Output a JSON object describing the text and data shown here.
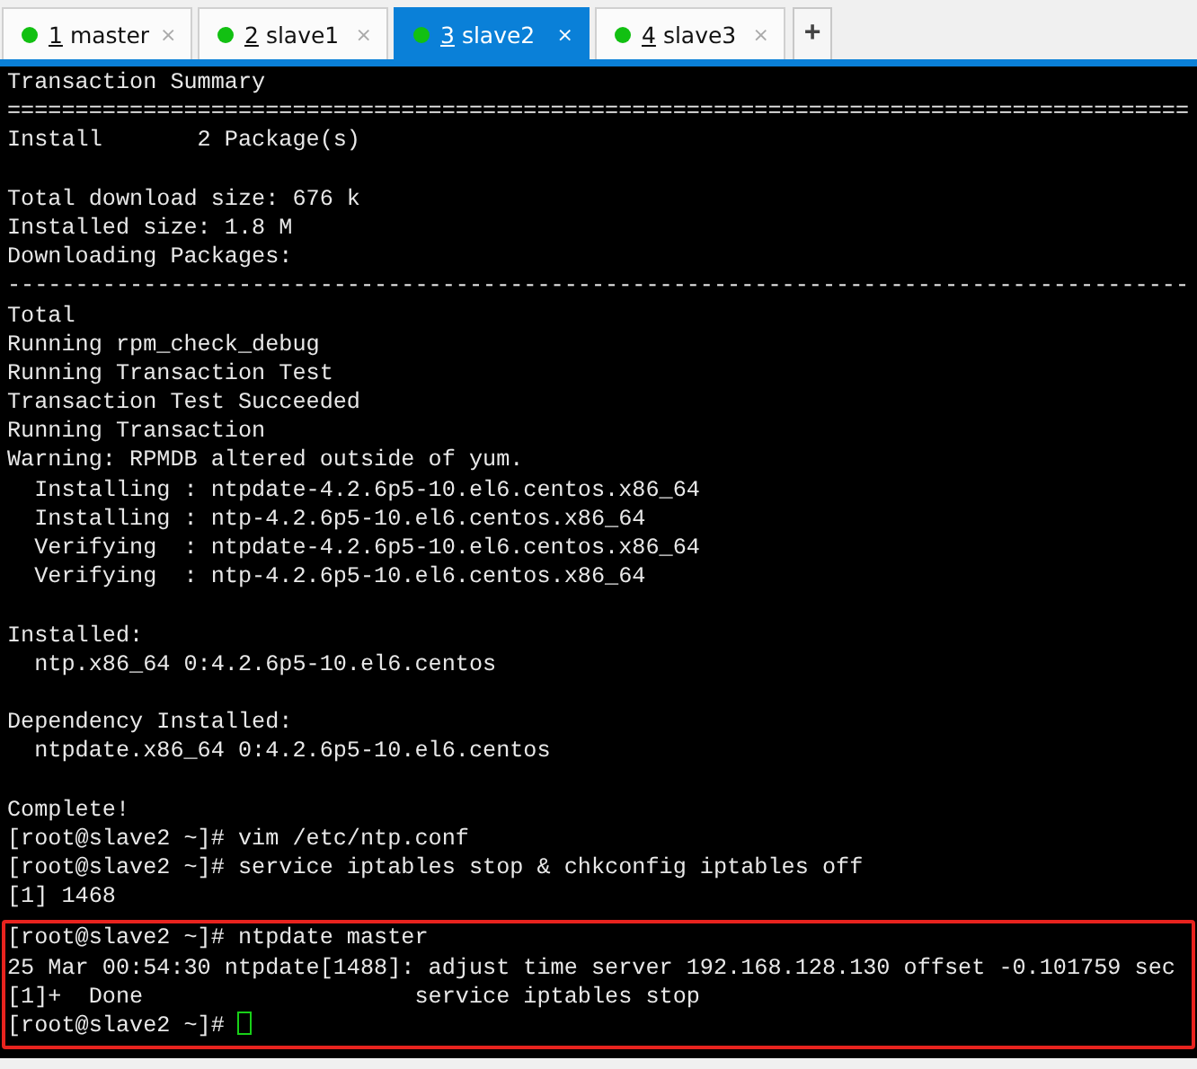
{
  "tabs": [
    {
      "number": "1",
      "label": "master",
      "selected": false,
      "close": "×"
    },
    {
      "number": "2",
      "label": "slave1",
      "selected": false,
      "close": "×"
    },
    {
      "number": "3",
      "label": "slave2",
      "selected": true,
      "close": "×"
    },
    {
      "number": "4",
      "label": "slave3",
      "selected": false,
      "close": "×"
    }
  ],
  "new_tab": "+",
  "terminal": {
    "lines": [
      {
        "kind": "text",
        "text": "Transaction Summary"
      },
      {
        "kind": "text",
        "text": "======================================================================================="
      },
      {
        "kind": "text",
        "text": "Install       2 Package(s)"
      },
      {
        "kind": "blank"
      },
      {
        "kind": "text",
        "text": "Total download size: 676 k"
      },
      {
        "kind": "text",
        "text": "Installed size: 1.8 M"
      },
      {
        "kind": "text",
        "text": "Downloading Packages:"
      },
      {
        "kind": "text",
        "text": "---------------------------------------------------------------------------------------"
      },
      {
        "kind": "text",
        "text": "Total"
      },
      {
        "kind": "text",
        "text": "Running rpm_check_debug"
      },
      {
        "kind": "text",
        "text": "Running Transaction Test"
      },
      {
        "kind": "text",
        "text": "Transaction Test Succeeded"
      },
      {
        "kind": "text",
        "text": "Running Transaction"
      },
      {
        "kind": "text",
        "text": "Warning: RPMDB altered outside of yum."
      },
      {
        "kind": "text",
        "text": "  Installing : ntpdate-4.2.6p5-10.el6.centos.x86_64"
      },
      {
        "kind": "text",
        "text": "  Installing : ntp-4.2.6p5-10.el6.centos.x86_64"
      },
      {
        "kind": "text",
        "text": "  Verifying  : ntpdate-4.2.6p5-10.el6.centos.x86_64"
      },
      {
        "kind": "text",
        "text": "  Verifying  : ntp-4.2.6p5-10.el6.centos.x86_64"
      },
      {
        "kind": "blank"
      },
      {
        "kind": "text",
        "text": "Installed:"
      },
      {
        "kind": "text",
        "text": "  ntp.x86_64 0:4.2.6p5-10.el6.centos"
      },
      {
        "kind": "blank"
      },
      {
        "kind": "text",
        "text": "Dependency Installed:"
      },
      {
        "kind": "text",
        "text": "  ntpdate.x86_64 0:4.2.6p5-10.el6.centos"
      },
      {
        "kind": "blank"
      },
      {
        "kind": "text",
        "text": "Complete!"
      },
      {
        "kind": "text",
        "text": "[root@slave2 ~]# vim /etc/ntp.conf"
      },
      {
        "kind": "text",
        "text": "[root@slave2 ~]# service iptables stop & chkconfig iptables off"
      },
      {
        "kind": "text",
        "text": "[1] 1468"
      }
    ],
    "highlighted_lines": [
      {
        "text": "[root@slave2 ~]# ntpdate master",
        "cursor": false
      },
      {
        "text": "25 Mar 00:54:30 ntpdate[1488]: adjust time server 192.168.128.130 offset -0.101759 sec",
        "cursor": false
      },
      {
        "text": "[1]+  Done                    service iptables stop",
        "cursor": false
      },
      {
        "text": "[root@slave2 ~]# ",
        "cursor": true
      }
    ]
  }
}
